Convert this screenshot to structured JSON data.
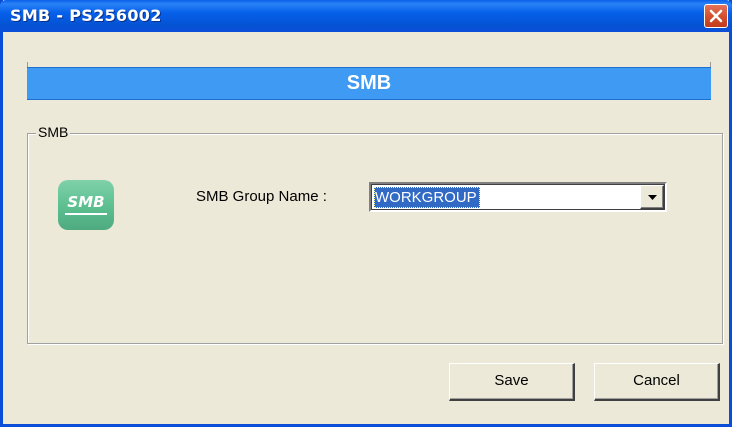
{
  "window": {
    "title": "SMB - PS256002",
    "close_icon": "close-icon"
  },
  "banner": {
    "title": "SMB"
  },
  "group": {
    "legend": "SMB",
    "logo_text": "SMB",
    "logo_icon": "smb-logo-icon"
  },
  "form": {
    "group_name_label": "SMB Group Name :",
    "group_name_value": "WORKGROUP",
    "dropdown_icon": "chevron-down-icon"
  },
  "buttons": {
    "save_label": "Save",
    "cancel_label": "Cancel"
  },
  "colors": {
    "titlebar": "#0a5fe8",
    "banner": "#3f9af3",
    "background": "#ece9d8",
    "close_button": "#d4512f",
    "selection": "#316ac5",
    "logo": "#5bbf8f"
  }
}
